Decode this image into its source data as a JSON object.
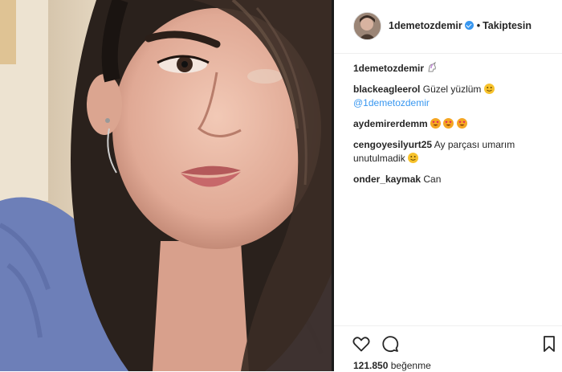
{
  "post": {
    "username": "1demetozdemir",
    "follow_separator": "•",
    "follow_state": "Takiptesin",
    "caption_user": "1demetozdemir",
    "caption_emoji": "unicorn-emoji",
    "likes_count": "121.850",
    "likes_label": "beğenme"
  },
  "comments": [
    {
      "user": "blackeagleerol",
      "text": "Güzel yüzlüm",
      "emoji": [
        "smiling-emoji"
      ],
      "mention": "@1demetozdemir"
    },
    {
      "user": "aydemirerdemm",
      "text": "",
      "emoji": [
        "heart-eyes-emoji",
        "heart-eyes-emoji",
        "heart-eyes-emoji"
      ]
    },
    {
      "user": "cengoyesilyurt25",
      "text": "Ay parçası umarım",
      "text2": "unutulmadik",
      "emoji": [
        "smiling-emoji"
      ]
    },
    {
      "user": "onder_kaymak",
      "text": "Can"
    }
  ],
  "colors": {
    "link": "#3897f0",
    "text": "#262626",
    "divider": "#1a1a1a",
    "sweater": "#6d7fb8"
  },
  "icons": [
    "heart-icon",
    "comment-icon",
    "bookmark-icon",
    "verified-badge-icon"
  ]
}
